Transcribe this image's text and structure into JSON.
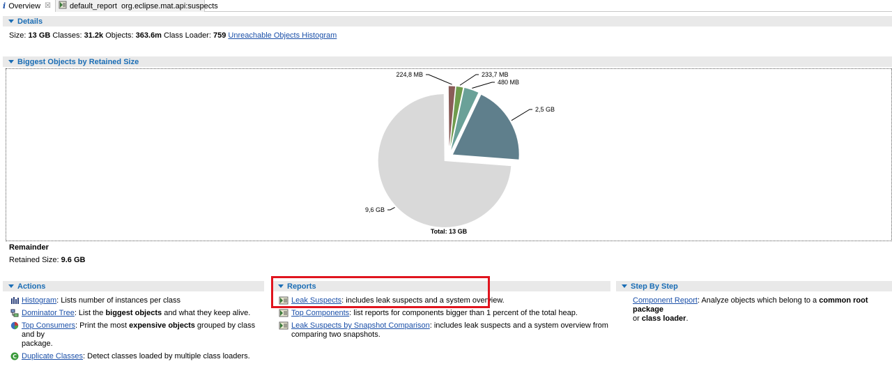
{
  "tabs": [
    {
      "label": "Overview",
      "active": true,
      "icon": "info-icon",
      "closable": true
    },
    {
      "label": "default_report  org.eclipse.mat.api:suspects",
      "active": false,
      "icon": "report-icon"
    }
  ],
  "details": {
    "header": "Details",
    "size_label": "Size:",
    "size_value": "13 GB",
    "classes_label": "Classes:",
    "classes_value": "31.2k",
    "objects_label": "Objects:",
    "objects_value": "363.6m",
    "loader_label": "Class Loader:",
    "loader_value": "759",
    "link": "Unreachable Objects Histogram"
  },
  "biggest": {
    "header": "Biggest Objects by Retained Size",
    "total_label": "Total: 13 GB"
  },
  "chart_data": {
    "type": "pie",
    "labels": [
      "2,5 GB",
      "480 MB",
      "233,7 MB",
      "224,8 MB",
      "9,6 GB"
    ],
    "values": [
      2.5,
      0.48,
      0.2337,
      0.2248,
      9.6
    ],
    "units": "GB",
    "colors": [
      "#5f7f8c",
      "#6aa198",
      "#6f9c4d",
      "#8a5c58",
      "#d9d9d9"
    ],
    "title": "",
    "total": "Total: 13 GB"
  },
  "remainder": {
    "title": "Remainder",
    "retained_label": "Retained Size:",
    "retained_value": "9.6 GB"
  },
  "actions": {
    "header": "Actions",
    "items": [
      {
        "link": "Histogram",
        "pre": ": Lists number of instances per class",
        "icon": "histogram-icon"
      },
      {
        "link": "Dominator Tree",
        "pre": ": List the ",
        "bold": "biggest objects",
        "post": " and what they keep alive.",
        "icon": "dominator-tree-icon"
      },
      {
        "link": "Top Consumers",
        "pre": ": Print the most ",
        "bold": "expensive objects",
        "post": " grouped by class and by",
        "line2": "package.",
        "icon": "top-consumers-icon"
      },
      {
        "link": "Duplicate Classes",
        "pre": ": Detect classes loaded by multiple class loaders.",
        "icon": "duplicate-classes-icon"
      }
    ]
  },
  "reports": {
    "header": "Reports",
    "items": [
      {
        "link": "Leak Suspects",
        "text": ": includes leak suspects and a system overview.",
        "icon": "report-icon"
      },
      {
        "link": "Top Components",
        "text": ": list reports for components bigger than 1 percent of the total heap.",
        "icon": "report-icon"
      },
      {
        "link": "Leak Suspects by Snapshot Comparison",
        "text": ": includes leak suspects and a system overview from",
        "line2": "comparing two snapshots.",
        "icon": "report-icon"
      }
    ]
  },
  "stepbystep": {
    "header": "Step By Step",
    "link": "Component Report",
    "pre": ": Analyze objects which belong to a ",
    "bold1": "common root package",
    "mid": "or ",
    "bold2": "class loader",
    "post": "."
  }
}
